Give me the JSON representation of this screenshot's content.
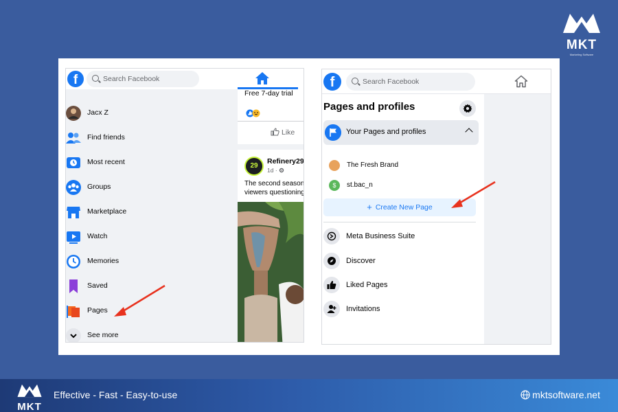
{
  "brand": {
    "name": "MKT",
    "tagline_small": "Marketing Software",
    "footer_tagline": "Effective - Fast - Easy-to-use",
    "website": "mktsoftware.net"
  },
  "left_screenshot": {
    "logo": "f",
    "search_placeholder": "Search Facebook",
    "nav_items": [
      {
        "label": "Jacx Z",
        "icon": "avatar-icon"
      },
      {
        "label": "Find friends",
        "icon": "friends-icon"
      },
      {
        "label": "Most recent",
        "icon": "clock-feed-icon"
      },
      {
        "label": "Groups",
        "icon": "groups-icon"
      },
      {
        "label": "Marketplace",
        "icon": "marketplace-icon"
      },
      {
        "label": "Watch",
        "icon": "watch-icon"
      },
      {
        "label": "Memories",
        "icon": "memories-icon"
      },
      {
        "label": "Saved",
        "icon": "bookmark-icon"
      },
      {
        "label": "Pages",
        "icon": "flag-icon"
      },
      {
        "label": "See more",
        "icon": "chevron-down-icon"
      }
    ],
    "feed": {
      "trial_text": "Free 7-day trial",
      "like_label": "Like",
      "post_author": "Refinery29",
      "post_time": "1d ·",
      "post_text_line1": "The second season",
      "post_text_line2": "viewers questioning"
    }
  },
  "right_screenshot": {
    "logo": "f",
    "search_placeholder": "Search Facebook",
    "title": "Pages and profiles",
    "section_label": "Your Pages and profiles",
    "pages": [
      {
        "name": "The Fresh Brand",
        "color": "#e8a25c"
      },
      {
        "name": "st.bac_n",
        "color": "#5cb85c"
      }
    ],
    "create_label": "Create New Page",
    "tools": [
      {
        "label": "Meta Business Suite",
        "icon": "business-suite-icon"
      },
      {
        "label": "Discover",
        "icon": "compass-icon"
      },
      {
        "label": "Liked Pages",
        "icon": "thumbs-up-icon"
      },
      {
        "label": "Invitations",
        "icon": "invite-user-icon"
      }
    ]
  },
  "colors": {
    "background": "#3a5c9e",
    "facebook_blue": "#1877f2",
    "arrow_red": "#e8321e"
  }
}
